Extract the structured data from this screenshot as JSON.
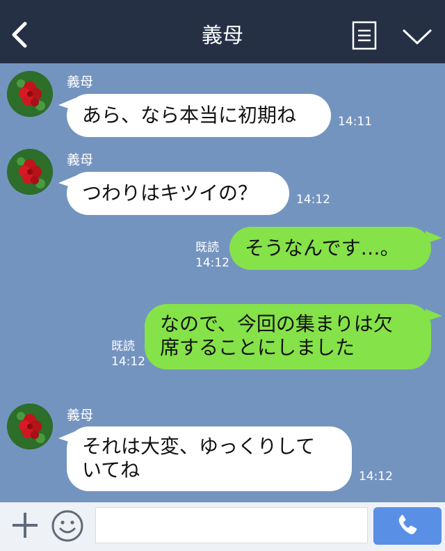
{
  "header": {
    "title": "義母"
  },
  "messages": [
    {
      "type": "in",
      "sender": "義母",
      "text": "あら、なら本当に初期ね",
      "time": "14:11"
    },
    {
      "type": "in",
      "sender": "義母",
      "text": "つわりはキツイの？",
      "time": "14:12"
    },
    {
      "type": "out",
      "read": "既読",
      "text": "そうなんです…。",
      "time": "14:12"
    },
    {
      "type": "out",
      "read": "既読",
      "line1": "なので、今回の集まりは欠",
      "line2": "席することにしました",
      "time": "14:12"
    },
    {
      "type": "in",
      "sender": "義母",
      "line1": "それは大変、ゆっくりして",
      "line2": "いてね",
      "time": "14:12"
    }
  ],
  "input": {
    "placeholder": "",
    "value": ""
  },
  "icons": {
    "back": "chevron-left-icon",
    "menu": "menu-list-icon",
    "collapse": "chevron-down-icon",
    "add": "plus-icon",
    "emoji": "smiley-icon",
    "call": "phone-icon"
  },
  "colors": {
    "header_bg": "#263045",
    "chat_bg": "#7494c0",
    "incoming_bubble": "#ffffff",
    "outgoing_bubble": "#85e249",
    "call_button": "#5a8fe6"
  }
}
